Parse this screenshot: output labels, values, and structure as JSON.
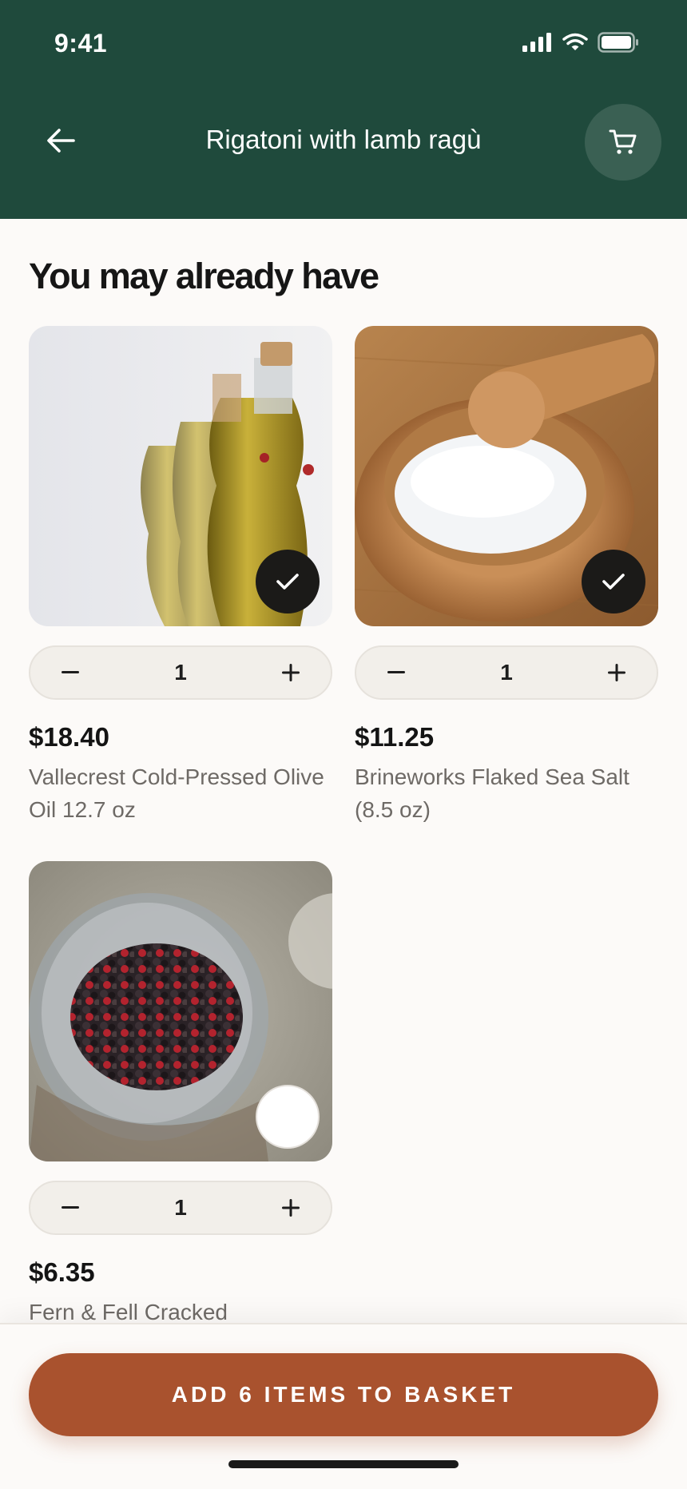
{
  "status_bar": {
    "time": "9:41"
  },
  "header": {
    "title": "Rigatoni with lamb ragù"
  },
  "section": {
    "title": "You may already have"
  },
  "products": [
    {
      "price": "$18.40",
      "name": "Vallecrest Cold-Pressed Olive Oil 12.7 oz",
      "quantity": "1",
      "selected": true,
      "image": "olive-oil-bottles-image"
    },
    {
      "price": "$11.25",
      "name": "Brineworks Flaked Sea Salt (8.5 oz)",
      "quantity": "1",
      "selected": true,
      "image": "sea-salt-bowl-image"
    },
    {
      "price": "$6.35",
      "name": "Fern & Fell Cracked",
      "quantity": "1",
      "selected": false,
      "image": "peppercorn-jar-image"
    }
  ],
  "footer": {
    "cta_label": "ADD 6 ITEMS TO BASKET"
  },
  "colors": {
    "header_bg": "#1f4a3c",
    "cta_bg": "#a9522e",
    "page_bg": "#fcfaf8"
  }
}
